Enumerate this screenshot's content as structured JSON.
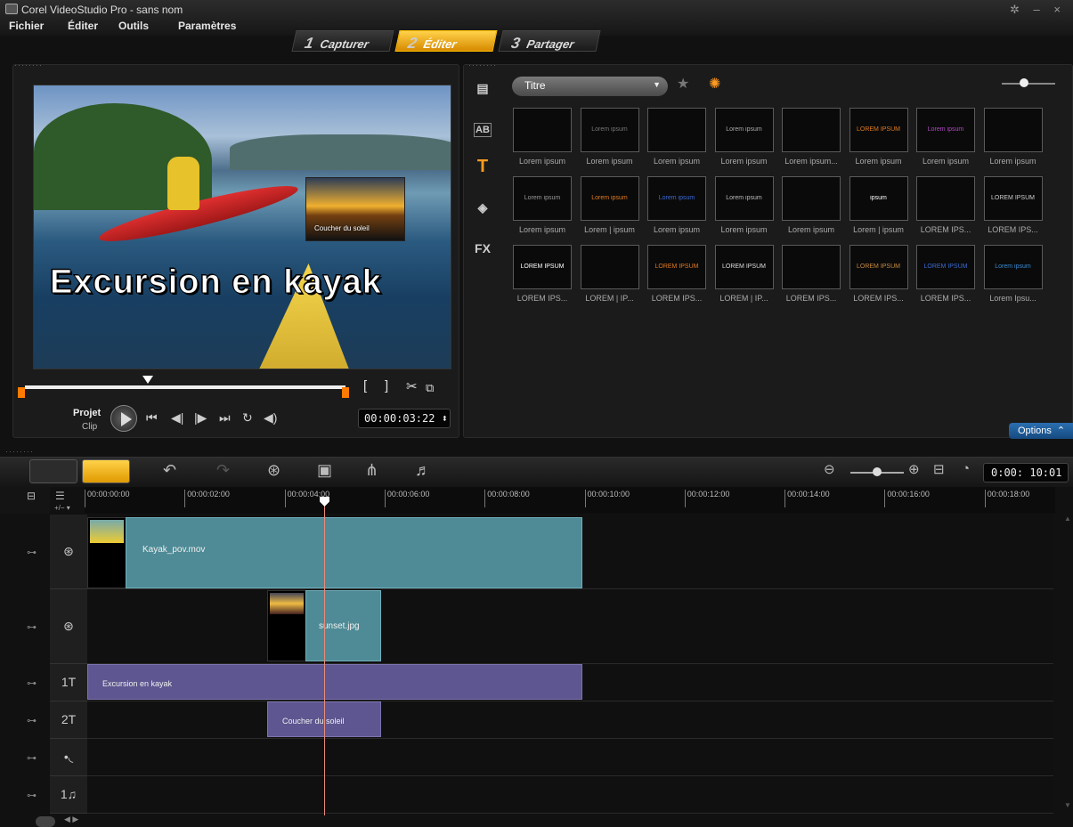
{
  "window": {
    "title": "Corel VideoStudio Pro - sans nom",
    "controls": "✲ – ×"
  },
  "menu": [
    "Fichier",
    "Éditer",
    "Outils",
    "Paramètres"
  ],
  "steps": [
    {
      "num": "1",
      "label": "Capturer",
      "active": false
    },
    {
      "num": "2",
      "label": "Éditer",
      "active": true
    },
    {
      "num": "3",
      "label": "Partager",
      "active": false
    }
  ],
  "preview": {
    "overlay_title": "Excursion en kayak",
    "overlay_caption": "Coucher du soleil",
    "project_label": "Projet",
    "clip_label": "Clip",
    "timecode": "00:00:03:22 ⬍",
    "trim_in": "[",
    "trim_out": "]"
  },
  "library": {
    "category": "Titre",
    "options": "Options",
    "side_tabs": [
      "media",
      "AB",
      "T",
      "graphic",
      "FX"
    ],
    "thumbs": [
      {
        "cap": "Lorem ipsum",
        "t": "",
        "c": "#333"
      },
      {
        "cap": "Lorem ipsum",
        "t": "Lorem ipsum",
        "c": "#777"
      },
      {
        "cap": "Lorem ipsum",
        "t": "",
        "c": "#333"
      },
      {
        "cap": "Lorem ipsum",
        "t": "Lorem ipsum",
        "c": "#aaa"
      },
      {
        "cap": "Lorem ipsum...",
        "t": "",
        "c": "#333"
      },
      {
        "cap": "Lorem ipsum",
        "t": "LOREM IPSUM",
        "c": "#e07a20"
      },
      {
        "cap": "Lorem ipsum",
        "t": "Lorem ipsum",
        "c": "#b04ac0"
      },
      {
        "cap": "Lorem ipsum",
        "t": "",
        "c": "#333"
      },
      {
        "cap": "Lorem ipsum",
        "t": "Lorem ipsum",
        "c": "#999"
      },
      {
        "cap": "Lorem | ipsum",
        "t": "Lorem ipsum",
        "c": "#e07a20"
      },
      {
        "cap": "Lorem ipsum",
        "t": "Lorem ipsum",
        "c": "#3a6ad0"
      },
      {
        "cap": "Lorem ipsum",
        "t": "Lorem ipsum",
        "c": "#bbb"
      },
      {
        "cap": "Lorem ipsum",
        "t": "",
        "c": "#333"
      },
      {
        "cap": "Lorem | ipsum",
        "t": "ipsum",
        "c": "#fff"
      },
      {
        "cap": "LOREM IPS...",
        "t": "",
        "c": "#333"
      },
      {
        "cap": "LOREM IPS...",
        "t": "LOREM IPSUM",
        "c": "#ccc"
      },
      {
        "cap": "LOREM IPS...",
        "t": "LOREM IPSUM",
        "c": "#fff"
      },
      {
        "cap": "LOREM | IP...",
        "t": "",
        "c": "#333"
      },
      {
        "cap": "LOREM IPS...",
        "t": "LOREM IPSUM",
        "c": "#e07a20"
      },
      {
        "cap": "LOREM | IP...",
        "t": "LOREM IPSUM",
        "c": "#ddd"
      },
      {
        "cap": "LOREM IPS...",
        "t": "",
        "c": "#333"
      },
      {
        "cap": "LOREM IPS...",
        "t": "LOREM IPSUM",
        "c": "#c88a40"
      },
      {
        "cap": "LOREM IPS...",
        "t": "LOREM IPSUM",
        "c": "#3a6ad0"
      },
      {
        "cap": "Lorem Ipsu...",
        "t": "Lorem ipsum",
        "c": "#3a8ad0"
      }
    ]
  },
  "timeline": {
    "timecode": "0:00: 10:01",
    "add_remove": "+/− ▾",
    "ruler": [
      "00:00:00:00",
      "00:00:02:00",
      "00:00:04:00",
      "00:00:06:00",
      "00:00:08:00",
      "00:00:10:00",
      "00:00:12:00",
      "00:00:14:00",
      "00:00:16:00",
      "00:00:18:00"
    ],
    "clips": {
      "video": "Kayak_pov.mov",
      "overlay": "sunset.jpg",
      "title1": "Excursion en kayak",
      "title2": "Coucher du soleil"
    },
    "track_labels": {
      "title1": "1T",
      "title2": "2T",
      "voice": "•◟",
      "music": "1♫"
    }
  }
}
